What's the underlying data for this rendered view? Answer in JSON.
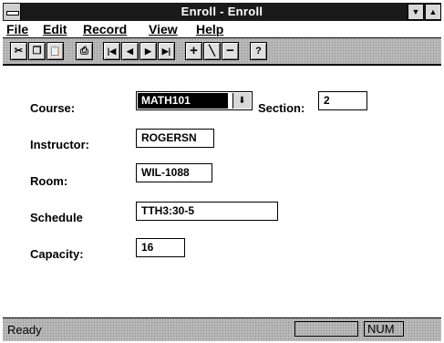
{
  "window": {
    "title": "Enroll - Enroll"
  },
  "menu": {
    "items": [
      "File",
      "Edit",
      "Record",
      "View",
      "Help"
    ]
  },
  "toolbar": {
    "buttons": [
      {
        "icon": "cut-icon",
        "glyph": "✂"
      },
      {
        "icon": "copy-icon",
        "glyph": "❐"
      },
      {
        "icon": "paste-icon",
        "glyph": "📋"
      },
      {
        "icon": "print-icon",
        "glyph": "⎙"
      },
      {
        "icon": "first-record-icon",
        "glyph": "|◀"
      },
      {
        "icon": "previous-record-icon",
        "glyph": "◀"
      },
      {
        "icon": "next-record-icon",
        "glyph": "▶"
      },
      {
        "icon": "last-record-icon",
        "glyph": "▶|"
      },
      {
        "icon": "add-record-icon",
        "glyph": "+"
      },
      {
        "icon": "edit-record-icon",
        "glyph": "╲"
      },
      {
        "icon": "delete-record-icon",
        "glyph": "−"
      },
      {
        "icon": "help-icon",
        "glyph": "?"
      }
    ]
  },
  "form": {
    "course_label": "Course:",
    "course_value": "MATH101",
    "section_label": "Section:",
    "section_value": "2",
    "instructor_label": "Instructor:",
    "instructor_value": "ROGERSN",
    "room_label": "Room:",
    "room_value": "WIL-1088",
    "schedule_label": "Schedule",
    "schedule_value": "TTH3:30-5",
    "capacity_label": "Capacity:",
    "capacity_value": "16"
  },
  "status": {
    "text": "Ready",
    "indicator": "NUM"
  }
}
